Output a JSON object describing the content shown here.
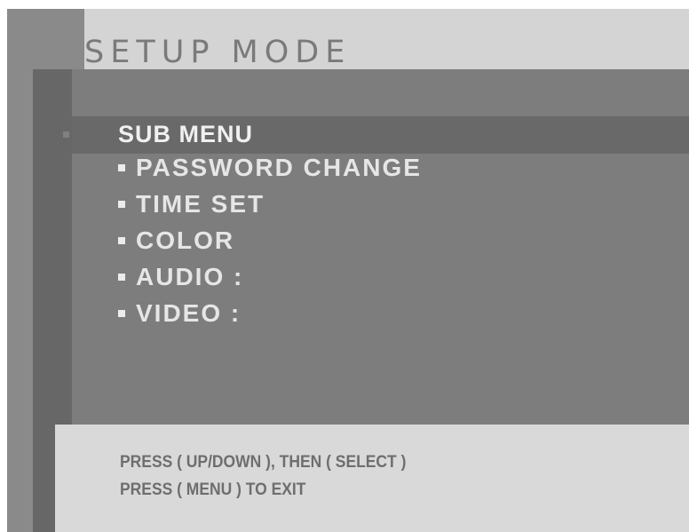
{
  "setup": {
    "title": "SETUP MODE"
  },
  "menu": {
    "header": "SUB MENU",
    "items": [
      {
        "label": "PASSWORD CHANGE"
      },
      {
        "label": "TIME SET"
      },
      {
        "label": "COLOR"
      },
      {
        "label": "AUDIO :"
      },
      {
        "label": "VIDEO :"
      }
    ]
  },
  "footer": {
    "line1": "PRESS ( UP/DOWN ), THEN ( SELECT )",
    "line2": "PRESS ( MENU ) TO EXIT"
  },
  "colors": {
    "background": "#d4d4d4",
    "menu_panel": "#7d7d7d",
    "highlight_row": "#696969",
    "menu_text": "#e6e6e6",
    "footer_text": "#6e6e6e"
  }
}
